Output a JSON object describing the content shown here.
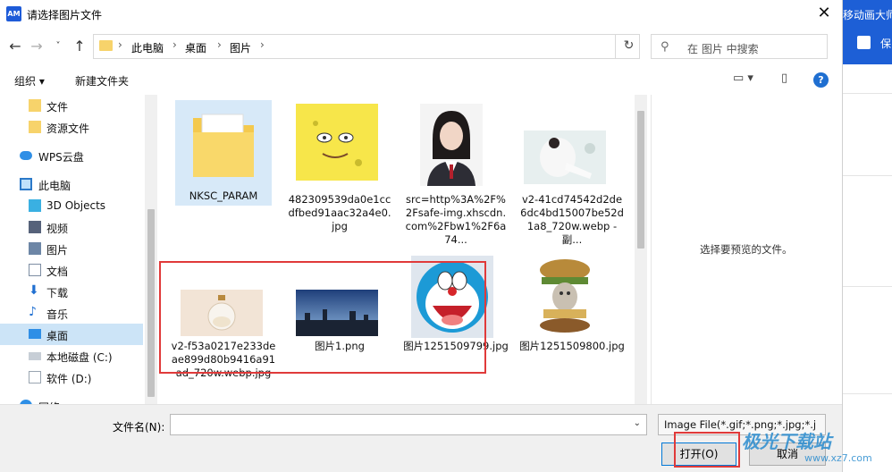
{
  "window": {
    "app_icon": "AM",
    "title": "请选择图片文件",
    "close": "✕"
  },
  "address": {
    "back": "←",
    "forward": "→",
    "history": "˅",
    "up": "↑",
    "crumbs": [
      "此电脑",
      "桌面",
      "图片"
    ],
    "sep": "›",
    "refresh": "↻",
    "dropdown": "⌄",
    "search_placeholder": "在 图片 中搜索"
  },
  "toolbar": {
    "organize": "组织 ▾",
    "new_folder": "新建文件夹",
    "view_icon": "▭ ▾",
    "pane_icon": "▯",
    "help": "?"
  },
  "nav": [
    {
      "label": "文件",
      "icon": "folder-icon"
    },
    {
      "label": "资源文件",
      "icon": "folder-icon"
    },
    {
      "label": "WPS云盘",
      "icon": "cloud-icon"
    },
    {
      "label": "此电脑",
      "icon": "computer-icon"
    },
    {
      "label": "3D Objects",
      "icon": "cube-icon"
    },
    {
      "label": "视频",
      "icon": "video-icon"
    },
    {
      "label": "图片",
      "icon": "picture-icon"
    },
    {
      "label": "文档",
      "icon": "document-icon"
    },
    {
      "label": "下载",
      "icon": "download-icon"
    },
    {
      "label": "音乐",
      "icon": "music-icon"
    },
    {
      "label": "桌面",
      "icon": "desktop-icon"
    },
    {
      "label": "本地磁盘 (C:)",
      "icon": "drive-icon"
    },
    {
      "label": "软件 (D:)",
      "icon": "drive-icon"
    },
    {
      "label": "网络",
      "icon": "network-icon"
    }
  ],
  "files": [
    {
      "name": "NKSC_PARAM",
      "kind": "folder"
    },
    {
      "name": "482309539da0e1ccdfbed91aac32a4e0.jpg",
      "kind": "yellow-sponge"
    },
    {
      "name": "src=http%3A%2F%2Fsafe-img.xhscdn.com%2Fbw1%2F6a74...",
      "kind": "portrait"
    },
    {
      "name": "v2-41cd74542d2de6dc4bd15007be52d1a8_720w.webp - 副...",
      "kind": "woman-white"
    },
    {
      "name": "v2-f53a0217e233deae899d80b9416a91ad_720w.webp.jpg",
      "kind": "bottle"
    },
    {
      "name": "图片1.png",
      "kind": "skyline"
    },
    {
      "name": "图片1251509799.jpg",
      "kind": "doraemon"
    },
    {
      "name": "图片1251509800.jpg",
      "kind": "burger-cat"
    }
  ],
  "preview": {
    "hint": "选择要预览的文件。"
  },
  "bottom": {
    "filename_label": "文件名(N):",
    "filename_value": "",
    "filetype": "Image File(*.gif;*.png;*.jpg;*.j",
    "open": "打开(O)",
    "cancel": "取消"
  },
  "side_app": {
    "title": "移动画大师",
    "save": "保"
  },
  "watermark": {
    "text": "极光下载站",
    "url": "www.xz7.com"
  }
}
